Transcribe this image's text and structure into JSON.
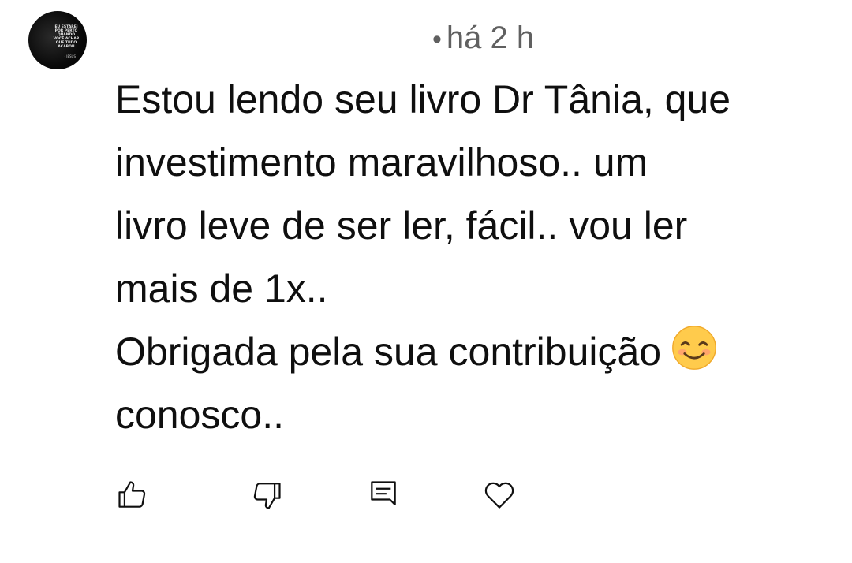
{
  "avatar": {
    "caption_text": "EU ESTAREI\nPOR PERTO\nQUANDO\nVOCÊ ACHAR\nQUE TUDO\nACABOU",
    "signature_text": "- JESUS"
  },
  "comment": {
    "time_separator": "•",
    "time": "há 2 h",
    "lines": [
      "Estou lendo seu livro Dr Tânia, que",
      "investimento maravilhoso.. um",
      "livro leve de ser ler, fácil.. vou ler",
      "mais de 1x..",
      "Obrigada pela sua contribuição",
      "conosco.."
    ],
    "emoji": "smiling-face-with-smiling-eyes"
  },
  "actions": {
    "icons": [
      "thumb-up-icon",
      "thumb-down-icon",
      "reply-icon",
      "heart-icon"
    ]
  },
  "colors": {
    "text": "#0f0f0f",
    "meta_text": "#606060",
    "emoji_face": "#ffcb4c",
    "emoji_cheek": "#ff8a80"
  }
}
